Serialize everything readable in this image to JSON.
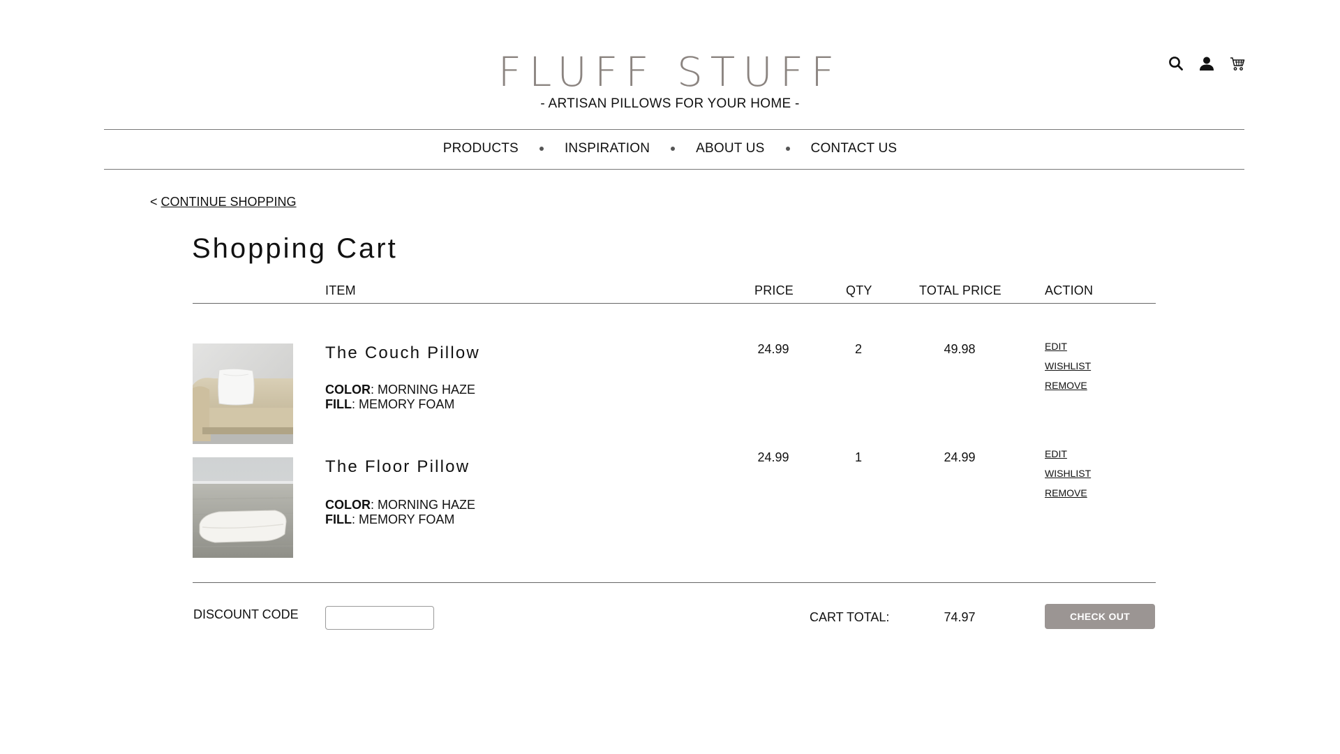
{
  "brand": {
    "logo_text": "FLUFF STUFF",
    "tagline": "- ARTISAN PILLOWS FOR YOUR HOME -",
    "logo_color": "#8b8480"
  },
  "header_icons": [
    "search-icon",
    "user-icon",
    "cart-icon"
  ],
  "nav": {
    "items": [
      "PRODUCTS",
      "INSPIRATION",
      "ABOUT US",
      "CONTACT US"
    ]
  },
  "continue_shopping": {
    "prefix": "<",
    "label": "CONTINUE SHOPPING"
  },
  "cart": {
    "title": "Shopping Cart",
    "columns": {
      "item": "ITEM",
      "price": "PRICE",
      "qty": "QTY",
      "total": "TOTAL PRICE",
      "action": "ACTION"
    },
    "items": [
      {
        "name": "The Couch Pillow",
        "color_label": "COLOR",
        "color_value": ": MORNING HAZE",
        "fill_label": "FILL",
        "fill_value": ": MEMORY FOAM",
        "price": "24.99",
        "qty": "2",
        "total": "49.98",
        "actions": [
          "EDIT",
          "WISHLIST",
          "REMOVE"
        ]
      },
      {
        "name": "The Floor Pillow",
        "color_label": "COLOR",
        "color_value": ": MORNING HAZE",
        "fill_label": "FILL",
        "fill_value": ": MEMORY FOAM",
        "price": "24.99",
        "qty": "1",
        "total": "24.99",
        "actions": [
          "EDIT",
          "WISHLIST",
          "REMOVE"
        ]
      }
    ],
    "discount_label": "DISCOUNT CODE",
    "discount_value": "",
    "cart_total_label": "CART TOTAL:",
    "cart_total_value": "74.97",
    "checkout_label": "CHECK OUT",
    "checkout_color": "#9b9593"
  }
}
